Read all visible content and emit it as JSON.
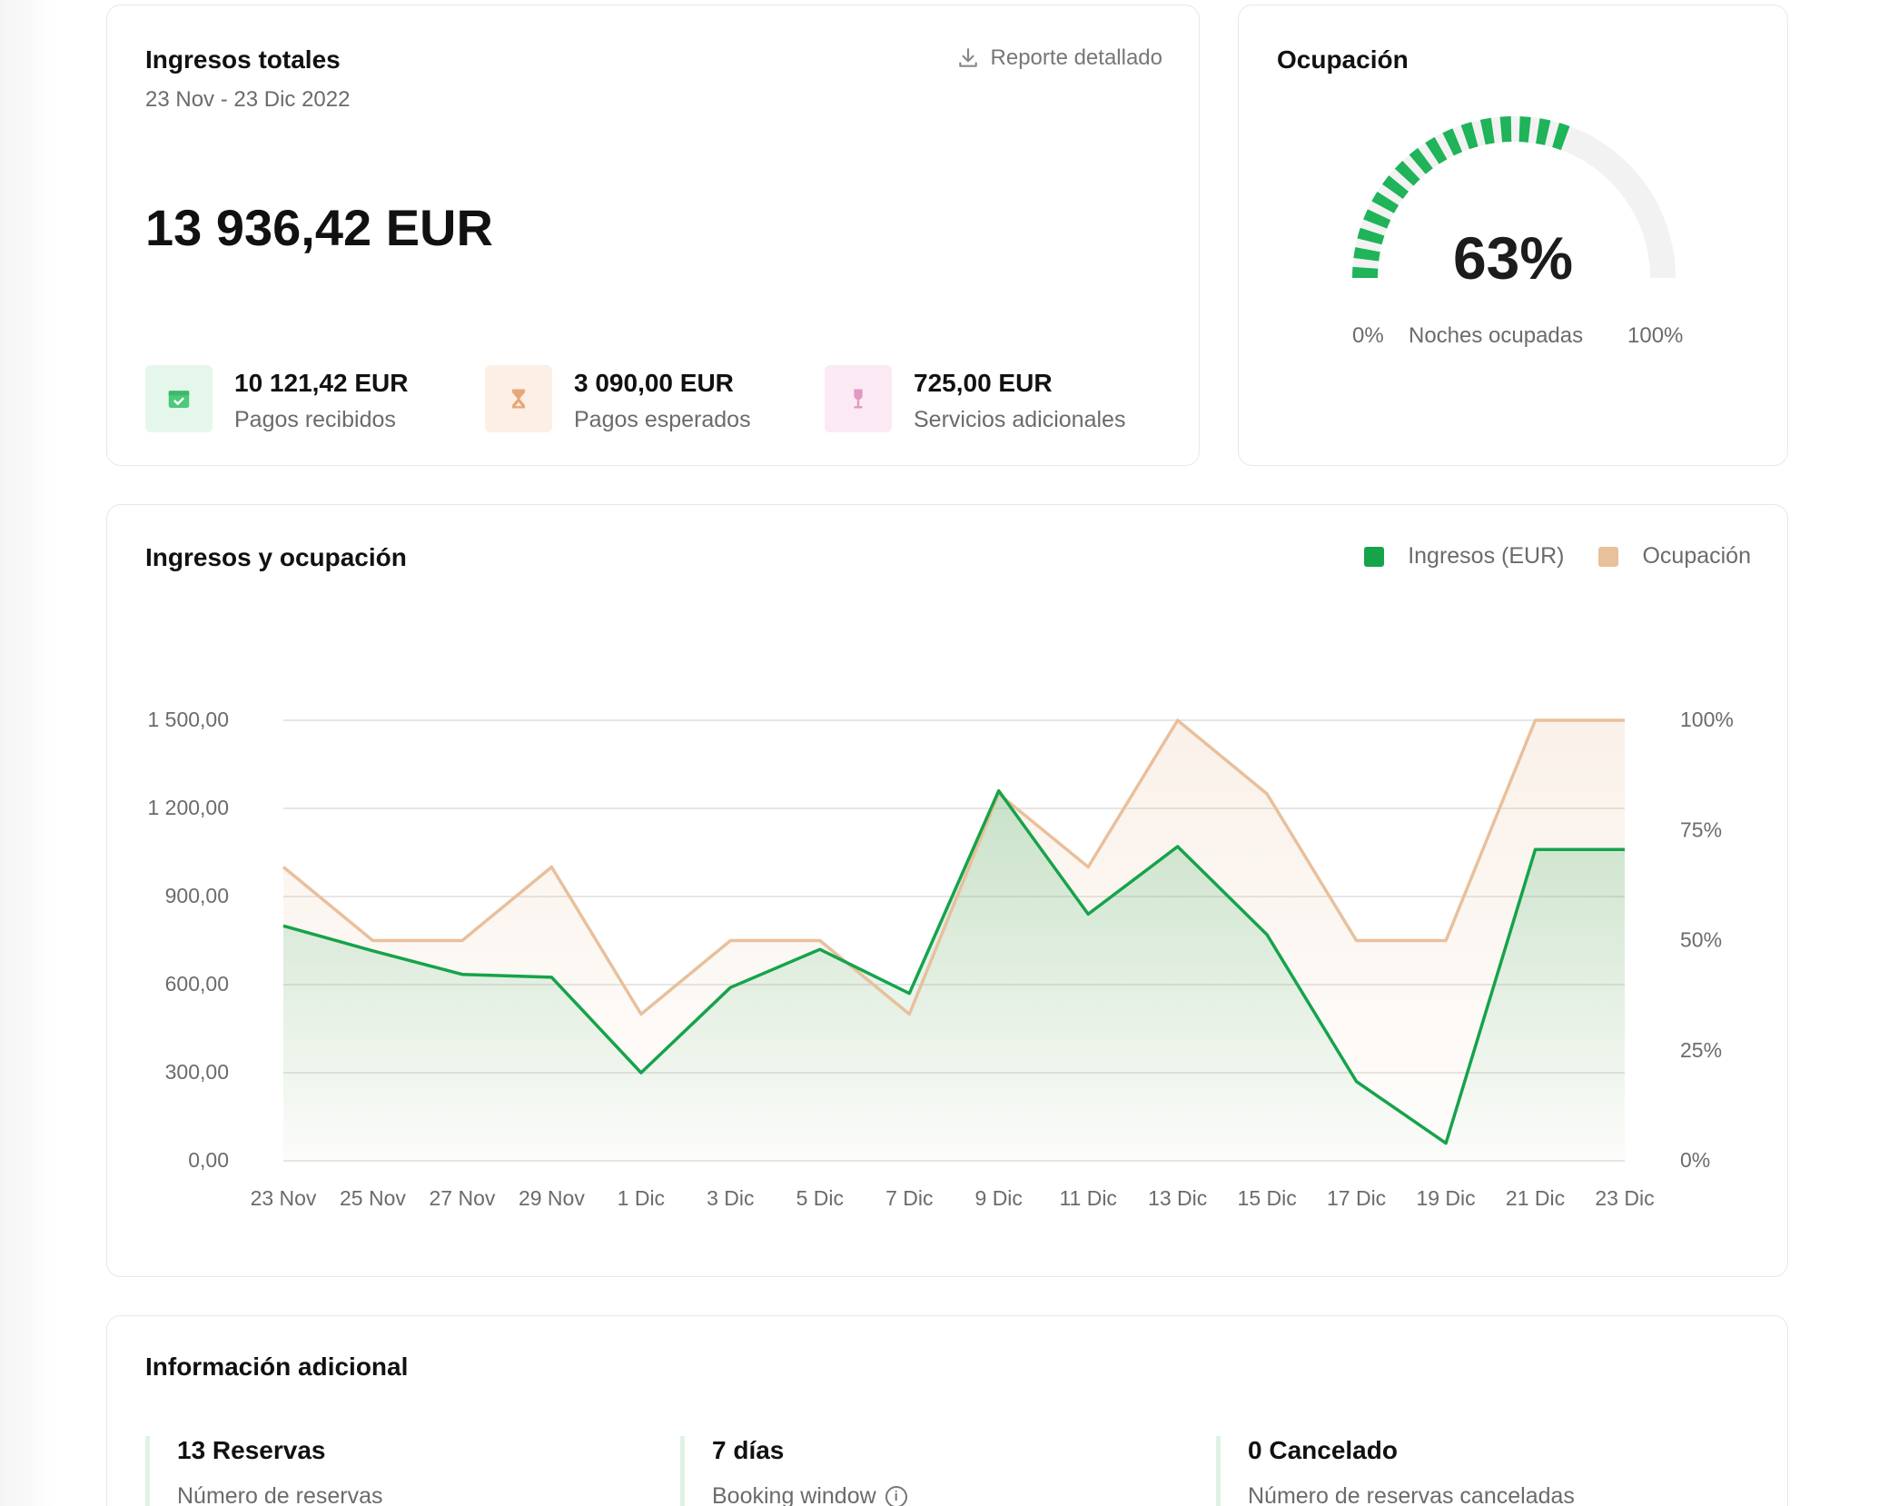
{
  "revenue": {
    "title": "Ingresos totales",
    "period": "23 Nov - 23 Dic 2022",
    "report_label": "Reporte detallado",
    "total": "13 936,42 EUR",
    "kpis": [
      {
        "value": "10 121,42 EUR",
        "label": "Pagos recibidos",
        "icon": "package-check-icon",
        "color": "#4cc97a",
        "bg": "#e5f7ea"
      },
      {
        "value": "3 090,00 EUR",
        "label": "Pagos esperados",
        "icon": "hourglass-icon",
        "color": "#e6a878",
        "bg": "#fcefe5"
      },
      {
        "value": "725,00 EUR",
        "label": "Servicios adicionales",
        "icon": "wine-glass-icon",
        "color": "#e398c4",
        "bg": "#fbeaf3"
      }
    ]
  },
  "occupancy": {
    "title": "Ocupación",
    "value": "63%",
    "fraction": 0.63,
    "min_label": "0%",
    "max_label": "100%",
    "label": "Noches ocupadas",
    "color": "#1fb35a",
    "track_color": "#f2f2f2"
  },
  "chart": {
    "title": "Ingresos y ocupación",
    "legend": [
      {
        "label": "Ingresos (EUR)",
        "color": "#16a34a"
      },
      {
        "label": "Ocupación",
        "color": "#e8c09c"
      }
    ]
  },
  "chart_data": {
    "type": "line",
    "x": [
      "23 Nov",
      "25 Nov",
      "27 Nov",
      "29 Nov",
      "1 Dic",
      "3 Dic",
      "5 Dic",
      "7 Dic",
      "9 Dic",
      "11 Dic",
      "13 Dic",
      "15 Dic",
      "17 Dic",
      "19 Dic",
      "21 Dic",
      "23 Dic"
    ],
    "series": [
      {
        "name": "Ingresos (EUR)",
        "axis": "left",
        "values": [
          800,
          715,
          635,
          625,
          300,
          590,
          720,
          570,
          1260,
          840,
          1070,
          770,
          270,
          60,
          1060,
          1060
        ]
      },
      {
        "name": "Ocupación",
        "axis": "right",
        "values": [
          66.7,
          50,
          50,
          66.7,
          33.3,
          50,
          50,
          33.3,
          83.3,
          66.7,
          100,
          83.3,
          50,
          50,
          100,
          100
        ]
      }
    ],
    "y_left": {
      "ticks": [
        "0,00",
        "300,00",
        "600,00",
        "900,00",
        "1 200,00",
        "1 500,00"
      ],
      "values": [
        0,
        300,
        600,
        900,
        1200,
        1500
      ],
      "range": [
        0,
        1500
      ]
    },
    "y_right": {
      "ticks": [
        "0%",
        "25%",
        "50%",
        "75%",
        "100%"
      ],
      "values": [
        0,
        25,
        50,
        75,
        100
      ],
      "range": [
        0,
        100
      ]
    },
    "grid": true,
    "legend_position": "top-right"
  },
  "info": {
    "title": "Información adicional",
    "items": [
      {
        "value": "13 Reservas",
        "label": "Número de reservas"
      },
      {
        "value": "7 días",
        "label": "Booking window",
        "info_icon": "i"
      },
      {
        "value": "0 Cancelado",
        "label": "Número de reservas canceladas"
      }
    ]
  }
}
